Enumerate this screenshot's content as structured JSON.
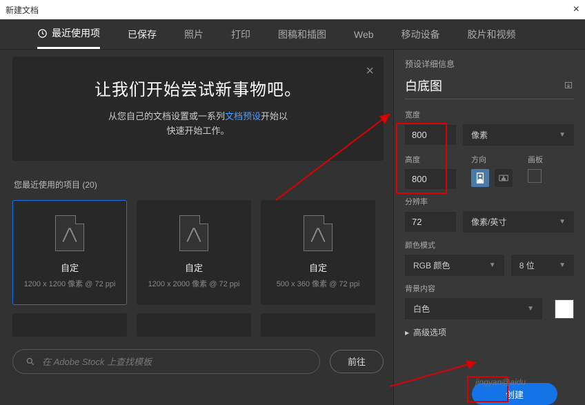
{
  "window": {
    "title": "新建文档"
  },
  "tabs": {
    "recent": "最近使用项",
    "saved": "已保存",
    "photo": "照片",
    "print": "打印",
    "illustration": "图稿和插图",
    "web": "Web",
    "mobile": "移动设备",
    "film": "胶片和视频"
  },
  "hero": {
    "title": "让我们开始尝试新事物吧。",
    "line1a": "从您自己的文档设置或一系列",
    "link": "文档预设",
    "line1b": "开始以",
    "line2": "快速开始工作。"
  },
  "section": {
    "recent_label": "您最近使用的项目",
    "recent_count": "(20)"
  },
  "presets": [
    {
      "name": "自定",
      "dim": "1200 x 1200 像素 @ 72 ppi"
    },
    {
      "name": "自定",
      "dim": "1200 x 2000 像素 @ 72 ppi"
    },
    {
      "name": "自定",
      "dim": "500 x 360 像素 @ 72 ppi"
    }
  ],
  "search": {
    "placeholder": "在 Adobe Stock 上查找模板",
    "go": "前往"
  },
  "details": {
    "header": "预设详细信息",
    "name": "白底图",
    "width_label": "宽度",
    "width": "800",
    "unit": "像素",
    "height_label": "高度",
    "height": "800",
    "orient_label": "方向",
    "artboard_label": "画板",
    "res_label": "分辨率",
    "res": "72",
    "res_unit": "像素/英寸",
    "mode_label": "颜色模式",
    "mode": "RGB 颜色",
    "depth": "8 位",
    "bg_label": "背景内容",
    "bg": "白色",
    "advanced": "高级选项",
    "create": "创建"
  },
  "watermark": "jingyan@aidu"
}
